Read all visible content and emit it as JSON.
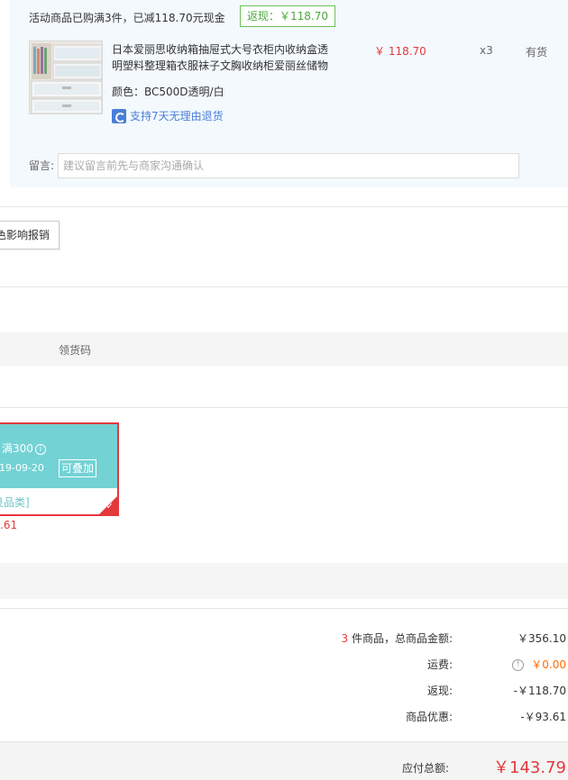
{
  "promo": {
    "text": "活动商品已购满3件，已减118.70元现金",
    "cashback_badge": "返现：￥118.70"
  },
  "product": {
    "title": "日本爱丽思收纳箱抽屉式大号衣柜内收纳盒透明塑料整理箱衣服袜子文胸收纳柜爱丽丝储物",
    "price": "￥ 118.70",
    "qty": "x3",
    "stock": "有货",
    "color": "颜色：BC500D透明/白",
    "return_policy": "支持7天无理由退货",
    "return_icon": "return-7day-icon"
  },
  "note": {
    "label": "留言:",
    "placeholder": "建议留言前先与商家沟通确认"
  },
  "invoice": {
    "button_label": "色影响报销"
  },
  "coupons": {
    "tab_get_coupon": "领货码",
    "card": {
      "condition": "满300",
      "date": "019-09-20",
      "stackable": "可叠加",
      "scope": "艮品类]"
    },
    "saving": ".61"
  },
  "summary": {
    "count": "3",
    "items_label": "件商品，总商品金额:",
    "items_value": "￥356.10",
    "freight_label": "运费:",
    "freight_value": "￥0.00",
    "cashback_label": "返现:",
    "cashback_value": "-￥118.70",
    "discount_label": "商品优惠:",
    "discount_value": "-￥93.61",
    "total_label": "应付总额:",
    "total_value": "￥143.79"
  },
  "colors": {
    "accent_red": "#e4393c",
    "cashback_green": "#4ba83a",
    "coupon_teal": "#73d2d4",
    "freight_orange": "#ff6b00",
    "link_blue": "#4a7ed9"
  }
}
